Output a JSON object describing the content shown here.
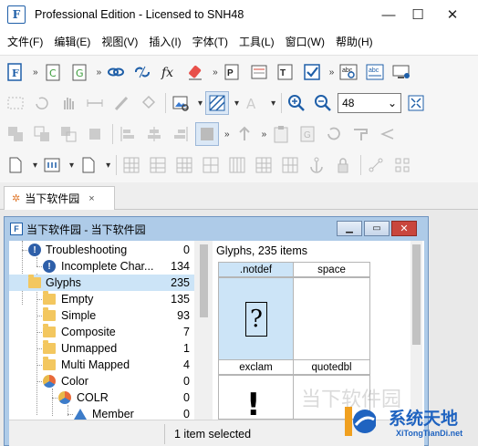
{
  "window": {
    "title": "Professional Edition - Licensed to SNH48",
    "minimize": "—",
    "maximize": "☐",
    "close": "✕"
  },
  "menu": [
    {
      "label": "文件(F)"
    },
    {
      "label": "编辑(E)"
    },
    {
      "label": "视图(V)"
    },
    {
      "label": "插入(I)"
    },
    {
      "label": "字体(T)"
    },
    {
      "label": "工具(L)"
    },
    {
      "label": "窗口(W)"
    },
    {
      "label": "帮助(H)"
    }
  ],
  "toolbar": {
    "zoom_value": "48",
    "icons": [
      "new-font-icon",
      "new-character-icon",
      "new-glyph-icon",
      "link-icon",
      "unlink-icon",
      "function-icon",
      "eraser-icon",
      "postscript-icon",
      "truetype-icon",
      "validate-icon",
      "spellcheck-icon",
      "abc-icon",
      "monitor-icon",
      "select-icon",
      "rotate-icon",
      "hand-icon",
      "measure-icon",
      "pen-icon",
      "fill-icon",
      "image-icon",
      "pattern-icon",
      "text-icon",
      "zoom-in-icon",
      "zoom-out-icon",
      "fit-icon"
    ]
  },
  "doc_tab": {
    "label": "当下软件园",
    "close": "×"
  },
  "child_window": {
    "title": "当下软件园 - 当下软件园",
    "btn_min": "▁",
    "btn_max": "▭",
    "btn_close": "✕"
  },
  "tree": [
    {
      "label": "Troubleshooting",
      "count": "0"
    },
    {
      "label": "Incomplete Char...",
      "count": "134"
    },
    {
      "label": "Glyphs",
      "count": "235"
    },
    {
      "label": "Empty",
      "count": "135"
    },
    {
      "label": "Simple",
      "count": "93"
    },
    {
      "label": "Composite",
      "count": "7"
    },
    {
      "label": "Unmapped",
      "count": "1"
    },
    {
      "label": "Multi Mapped",
      "count": "4"
    },
    {
      "label": "Color",
      "count": "0"
    },
    {
      "label": "COLR",
      "count": "0"
    },
    {
      "label": "Member",
      "count": "0"
    }
  ],
  "glyphs": {
    "header": "Glyphs, 235 items",
    "cells": [
      {
        "name": ".notdef",
        "glyph": "?"
      },
      {
        "name": "space",
        "glyph": ""
      },
      {
        "name": "exclam",
        "glyph": "!"
      },
      {
        "name": "quotedbl",
        "glyph": ""
      }
    ]
  },
  "status": {
    "selection": "1 item selected"
  },
  "watermark": {
    "text": "系统天地",
    "url": "XiTongTianDi.net",
    "faint": "当下软件园"
  },
  "colors": {
    "selection": "#cce4f7",
    "child_frame": "#aecbe8",
    "close_red": "#c9463d",
    "folder": "#f3c75f",
    "accent": "#1f5fa8"
  }
}
